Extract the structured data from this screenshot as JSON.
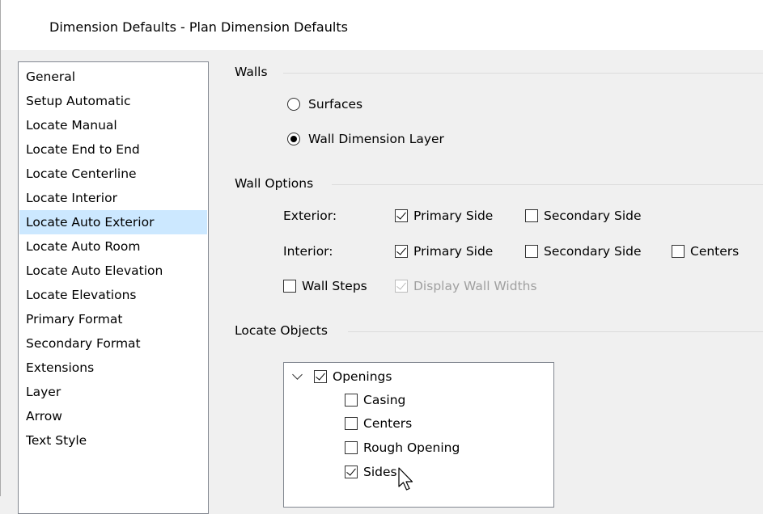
{
  "window": {
    "title": "Dimension Defaults - Plan Dimension Defaults"
  },
  "sidebar": {
    "items": [
      {
        "label": "General"
      },
      {
        "label": "Setup Automatic"
      },
      {
        "label": "Locate Manual"
      },
      {
        "label": "Locate End to End"
      },
      {
        "label": "Locate Centerline"
      },
      {
        "label": "Locate Interior"
      },
      {
        "label": "Locate Auto Exterior",
        "selected": true
      },
      {
        "label": "Locate Auto Room"
      },
      {
        "label": "Locate Auto Elevation"
      },
      {
        "label": "Locate Elevations"
      },
      {
        "label": "Primary Format"
      },
      {
        "label": "Secondary Format"
      },
      {
        "label": "Extensions"
      },
      {
        "label": "Layer"
      },
      {
        "label": "Arrow"
      },
      {
        "label": "Text Style"
      }
    ]
  },
  "walls": {
    "label": "Walls",
    "surfaces": "Surfaces",
    "wall_dimension_layer": "Wall Dimension Layer",
    "selected": "Wall Dimension Layer"
  },
  "wall_options": {
    "label": "Wall Options",
    "exterior_label": "Exterior:",
    "interior_label": "Interior:",
    "primary_side": "Primary Side",
    "secondary_side": "Secondary Side",
    "centers": "Centers",
    "wall_steps": "Wall Steps",
    "display_wall_widths": "Display Wall Widths",
    "state": {
      "exterior_primary": true,
      "exterior_secondary": false,
      "interior_primary": true,
      "interior_secondary": false,
      "interior_centers": false,
      "wall_steps": false,
      "display_wall_widths": true,
      "display_wall_widths_disabled": true
    }
  },
  "locate_objects": {
    "label": "Locate Objects",
    "tree": {
      "root": {
        "label": "Openings",
        "checked": true,
        "expanded": true
      },
      "children": [
        {
          "label": "Casing",
          "checked": false
        },
        {
          "label": "Centers",
          "checked": false
        },
        {
          "label": "Rough Opening",
          "checked": false
        },
        {
          "label": "Sides",
          "checked": true
        }
      ]
    }
  },
  "icons": {
    "cursor": "arrow-cursor-icon",
    "expand": "chevron-down-icon"
  }
}
